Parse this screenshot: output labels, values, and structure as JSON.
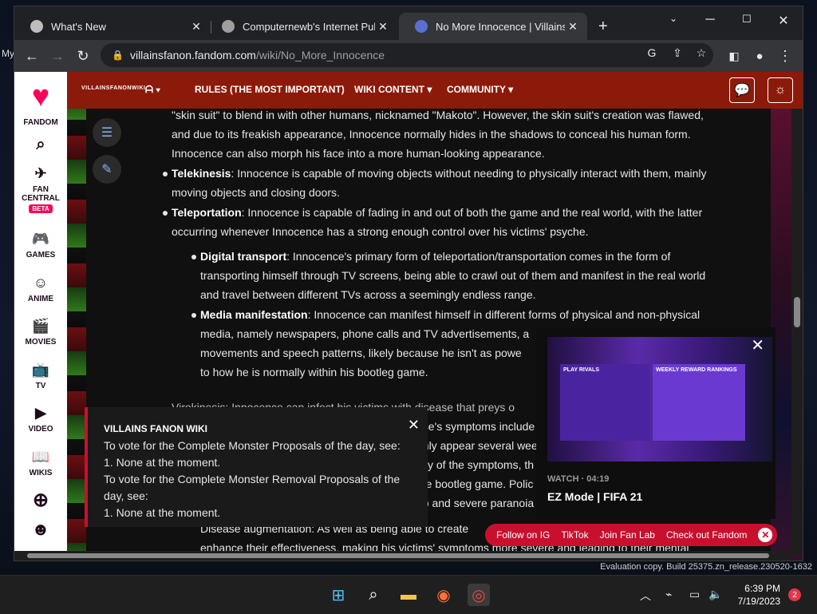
{
  "browser": {
    "tabs": [
      {
        "title": "What's New",
        "active": false
      },
      {
        "title": "Computernewb's Internet Pub H",
        "active": false
      },
      {
        "title": "No More Innocence | Villains Fa",
        "active": true
      }
    ],
    "url_host": "villainsfanon.fandom.com",
    "url_path": "/wiki/No_More_Innocence"
  },
  "fandom_rail": {
    "logo_label": "FANDOM",
    "fan_central": "FAN CENTRAL",
    "beta": "BETA",
    "games": "GAMES",
    "anime": "ANIME",
    "movies": "MOVIES",
    "tv": "TV",
    "video": "VIDEO",
    "wikis": "WIKIS"
  },
  "wiki_nav": {
    "logo_text": "VILLAINSFANONWIKI",
    "rules": "RULES (THE MOST IMPORTANT)",
    "wiki_content": "WIKI CONTENT",
    "community": "COMMUNITY"
  },
  "article": {
    "l1": "\"skin suit\" to blend in with other humans, nicknamed \"Makoto\". However, the skin suit's creation was flawed,",
    "l2": "and due to its freakish appearance, Innocence normally hides in the shadows to conceal his human form.",
    "l3": "Innocence can also morph his face into a more human-looking appearance.",
    "tele_term": "Telekinesis",
    "tele_1": ": Innocence is capable of moving objects without needing to physically interact with them, mainly",
    "tele_2": "moving objects and closing doors.",
    "tp_term": "Teleportation",
    "tp_1": ": Innocence is capable of fading in and out of both the game and the real world, with the latter",
    "tp_2": "occurring whenever Innocence has a strong enough control over his victims' psyche.",
    "dt_term": "Digital transport",
    "dt_1": ": Innocence's primary form of teleportation/transportation comes in the form of",
    "dt_2": "transporting himself through TV screens, being able to crawl out of them and manifest in the real world",
    "dt_3": "and travel between different TVs across a seemingly endless range.",
    "mm_term": "Media manifestation",
    "mm_1": ": Innocence can manifest himself in different forms of physical and non-physical",
    "mm_2": "media, namely newspapers, phone calls and TV advertisements, a",
    "mm_3": "movements and speech patterns, likely because he isn't as powe",
    "mm_4": "to how he is normally within his bootleg game.",
    "vk_frag": "Virokinesis: Innocence can infect his victims with disease that preys o",
    "r1": "nce's symptoms include",
    "r2": "only appear several wee",
    "r3": "sity of the symptoms, th",
    "r4": "the bootleg game. Polic",
    "r5": "ep and severe paranoia",
    "da_frag": "Disease augmentation: As well as being able to create",
    "bottom_line": "enhance their effectiveness, making his victims' symptoms more severe and leading to their mental"
  },
  "notice": {
    "title": "VILLAINS FANON WIKI",
    "l1": "To vote for the Complete Monster Proposals of the day, see:",
    "l2": "1. None at the moment.",
    "l3": "To vote for the Complete Monster Removal Proposals of the",
    "l4": "day, see:",
    "l5": "1. None at the moment."
  },
  "video": {
    "meta": "WATCH · 04:19",
    "title": "EZ Mode | FIFA 21",
    "thumb_left": "PLAY RIVALS",
    "thumb_right": "WEEKLY REWARD RANKINGS"
  },
  "fan_links": [
    "Follow on IG",
    "TikTok",
    "Join Fan Lab",
    "Check out Fandom"
  ],
  "desktop": {
    "build": "Evaluation copy. Build 25375.zn_release.230520-1632",
    "left_text": "My"
  },
  "taskbar": {
    "time": "6:39 PM",
    "date": "7/19/2023",
    "notifications": "2"
  }
}
